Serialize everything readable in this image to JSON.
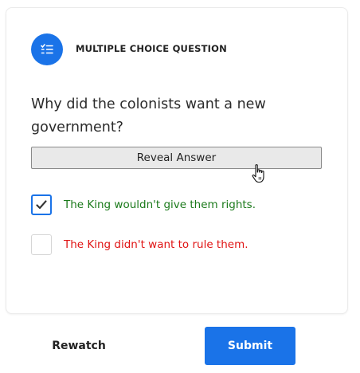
{
  "question_card": {
    "type_icon": "list-check-icon",
    "type_label": "MULTIPLE CHOICE QUESTION",
    "question_text": "Why did the colonists want a new government?",
    "reveal_button_label": "Reveal Answer",
    "options": [
      {
        "label": "The King wouldn't give them rights.",
        "checked": true,
        "status": "correct",
        "color": "#1b7a1b"
      },
      {
        "label": "The King didn't want to rule them.",
        "checked": false,
        "status": "incorrect",
        "color": "#e01414"
      }
    ]
  },
  "footer": {
    "rewatch_label": "Rewatch",
    "submit_label": "Submit"
  },
  "colors": {
    "accent": "#1a73e8"
  }
}
